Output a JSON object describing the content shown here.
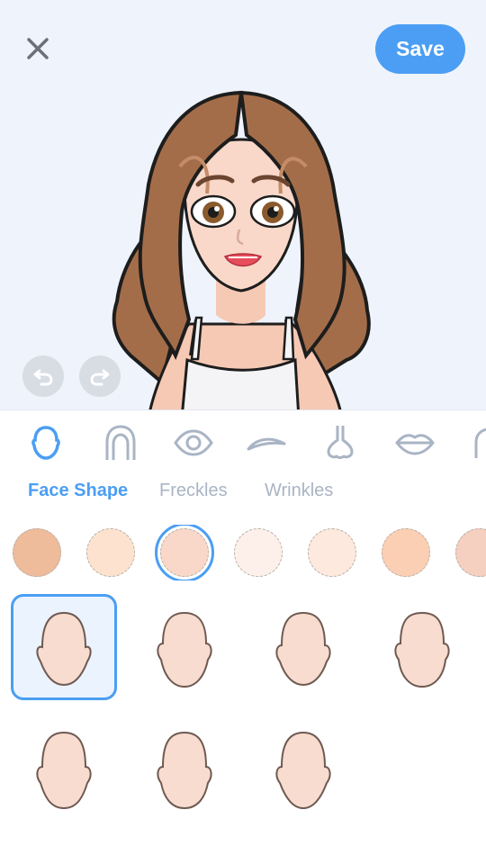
{
  "header": {
    "close_icon": "close-icon",
    "save_label": "Save",
    "accent_color": "#4b9ef3"
  },
  "preview": {
    "background": "#eff3fb",
    "undo_icon": "undo-icon",
    "redo_icon": "redo-icon"
  },
  "categories": [
    {
      "name": "face",
      "icon": "face-outline-icon",
      "active": true
    },
    {
      "name": "hair",
      "icon": "hair-outline-icon",
      "active": false
    },
    {
      "name": "eyes",
      "icon": "eye-icon",
      "active": false
    },
    {
      "name": "eyebrows",
      "icon": "eyebrow-icon",
      "active": false
    },
    {
      "name": "nose",
      "icon": "nose-icon",
      "active": false
    },
    {
      "name": "mouth",
      "icon": "lips-icon",
      "active": false
    },
    {
      "name": "ears",
      "icon": "ear-icon",
      "active": false
    }
  ],
  "tabs": [
    {
      "label": "Face Shape",
      "active": true
    },
    {
      "label": "Freckles",
      "active": false
    },
    {
      "label": "Wrinkles",
      "active": false
    }
  ],
  "skin_tones": [
    {
      "color": "#eebb9b",
      "selected": false
    },
    {
      "color": "#fde3cf",
      "selected": false
    },
    {
      "color": "#f9d8c9",
      "selected": true
    },
    {
      "color": "#fdf0eb",
      "selected": false
    },
    {
      "color": "#fde9de",
      "selected": false
    },
    {
      "color": "#fbcfb4",
      "selected": false
    },
    {
      "color": "#f5cfc0",
      "selected": false
    }
  ],
  "face_shapes": [
    {
      "shape": "oval-wide",
      "selected": true
    },
    {
      "shape": "round",
      "selected": false
    },
    {
      "shape": "heart",
      "selected": false
    },
    {
      "shape": "square",
      "selected": false
    },
    {
      "shape": "egg",
      "selected": false
    },
    {
      "shape": "long",
      "selected": false
    },
    {
      "shape": "diamond",
      "selected": false
    }
  ],
  "face_fill_color": "#f8dccf"
}
